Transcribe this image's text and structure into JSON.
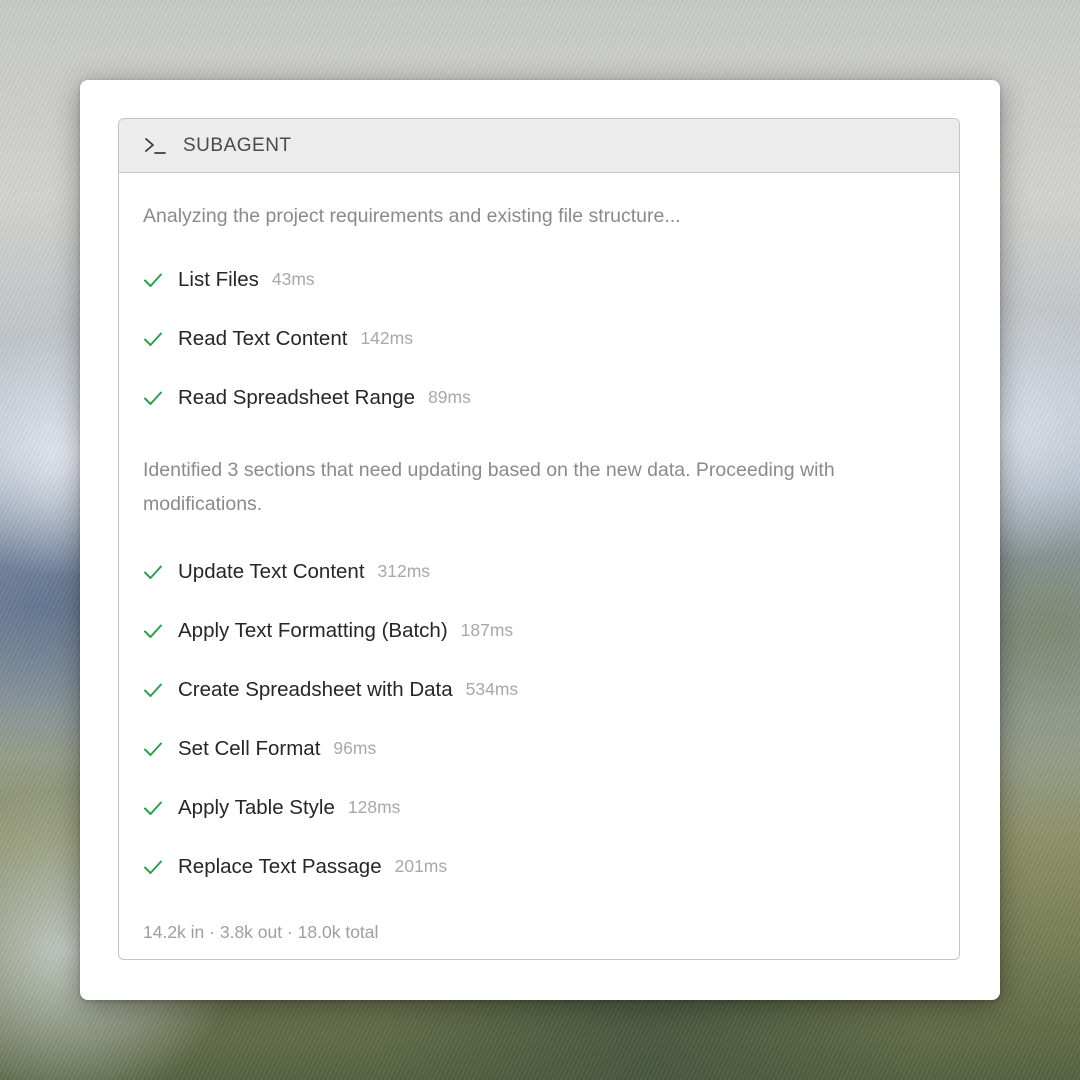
{
  "panel": {
    "title": "SUBAGENT",
    "icon": "terminal-icon"
  },
  "messages": {
    "intro": "Analyzing the project requirements and existing file structure...",
    "progress": "Identified 3 sections that need updating based on the new data. Proceeding with modifications."
  },
  "steps_group_1": [
    {
      "label": "List Files",
      "time": "43ms",
      "status": "done"
    },
    {
      "label": "Read Text Content",
      "time": "142ms",
      "status": "done"
    },
    {
      "label": "Read Spreadsheet Range",
      "time": "89ms",
      "status": "done"
    }
  ],
  "steps_group_2": [
    {
      "label": "Update Text Content",
      "time": "312ms",
      "status": "done"
    },
    {
      "label": "Apply Text Formatting (Batch)",
      "time": "187ms",
      "status": "done"
    },
    {
      "label": "Create Spreadsheet with Data",
      "time": "534ms",
      "status": "done"
    },
    {
      "label": "Set Cell Format",
      "time": "96ms",
      "status": "done"
    },
    {
      "label": "Apply Table Style",
      "time": "128ms",
      "status": "done"
    },
    {
      "label": "Replace Text Passage",
      "time": "201ms",
      "status": "done"
    }
  ],
  "footer": {
    "tokens": "14.2k in · 3.8k out · 18.0k total"
  },
  "colors": {
    "check": "#2e9e4f",
    "header_bg": "#ececec",
    "muted_text": "#8a8a8a"
  }
}
